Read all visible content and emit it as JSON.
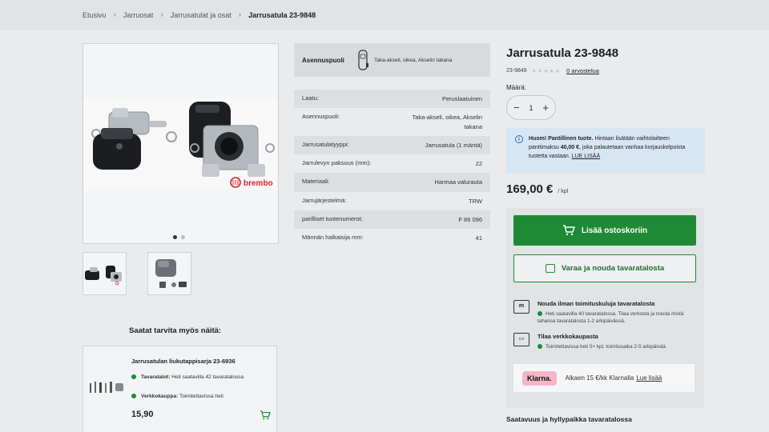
{
  "breadcrumb": {
    "items": [
      "Etusivu",
      "Jarruosat",
      "Jarrusatulat ja osat"
    ],
    "current": "Jarrusatula 23-9848"
  },
  "gallery": {
    "main_image": "brake-caliper-photo",
    "brand_text": "brembo",
    "dots": 2,
    "active_dot": 1,
    "thumbnails": [
      "brake-caliper-pair",
      "caliper-motor-kit"
    ]
  },
  "mount": {
    "label": "Asennuspuoli",
    "value": "Taka-akseli, oikea, Akselin takana"
  },
  "specs": [
    {
      "k": "Laatu:",
      "v": "Peruslaatuinen"
    },
    {
      "k": "Asennuspuoli:",
      "v": "Taka-akseli, oikea, Akselin takana"
    },
    {
      "k": "Jarrusatulatyyppi:",
      "v": "Jarrusatula (1 mäntä)"
    },
    {
      "k": "Jarrulevyn paksuus (mm):",
      "v": "22"
    },
    {
      "k": "Materiaali:",
      "v": "Harmaa valurauta"
    },
    {
      "k": "Jarrujärjestelmä:",
      "v": "TRW"
    },
    {
      "k": "parilliset tuotenumerot:",
      "v": "F 86 096"
    },
    {
      "k": "Männän halkaisija mm:",
      "v": "41"
    }
  ],
  "product": {
    "title": "Jarrusatula 23-9848",
    "sku": "23-9848",
    "stars": "★★★★★",
    "reviews": "0 arvostelua",
    "qty_label": "Määrä:",
    "qty": "1",
    "minus": "−",
    "plus": "+",
    "notice_strong": "Huom! Pantillinen tuote.",
    "notice_text_1": " Hintaan lisätään vaihtolaitteen panttimaksu ",
    "notice_amount": "40,00 €",
    "notice_text_2": ", joka palautetaan vanhaa korjauskelpoista tuotetta vastaan. ",
    "notice_link": "LUE LISÄÄ",
    "price": "169,00 €",
    "unit": "/ kpl"
  },
  "actions": {
    "cart_label": "Lisää ostoskoriin",
    "reserve_label": "Varaa ja nouda tavaratalosta"
  },
  "shipping": [
    {
      "title": "Nouda ilman toimituskuluja tavaratalosta",
      "line": "Heti saatavilla 40 tavaratalossa. Tilaa verkosta ja nouda mistä tahansa tavaratalosta 1-2 arkipäivässä.",
      "icon": "store-icon"
    },
    {
      "title": "Tilaa verkkokaupasta",
      "line": "Toimitettavissa heti 5+ kpl, toimitusaika 2-5 arkipäivää",
      "icon": "truck-icon"
    }
  ],
  "klarna": {
    "logo": "Klarna.",
    "text": "Alkaen 15 €/kk Klarnalla",
    "link": "Lue lisää"
  },
  "availability_heading": "Saatavuus ja hyllypaikka tavaratalossa",
  "also": {
    "title": "Saatat tarvita myös näitä:",
    "product_name": "Jarrusatulan liukutappisarja 23-6936",
    "stores_label": "Tavaratalot:",
    "stores_text": "Heti saatavilla 42 tavaratalossa",
    "online_label": "Verkkokauppa:",
    "online_text": "Toimitettavissa heti",
    "price": "15,90"
  },
  "colors": {
    "accent_green": "#1e8a36",
    "notice_blue": "#d6e6f4",
    "klarna_pink": "#f4b6c7",
    "brand_red": "#d8232a"
  }
}
